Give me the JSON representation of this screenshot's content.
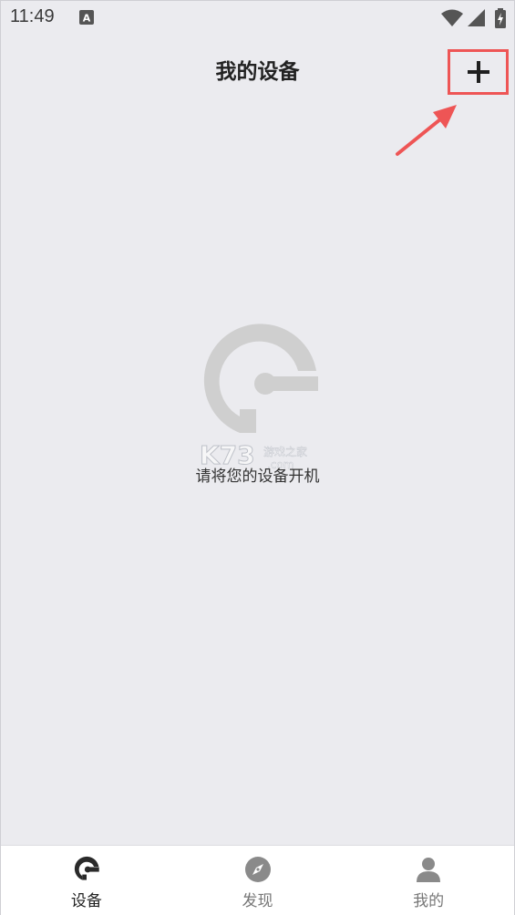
{
  "status_bar": {
    "time": "11:49",
    "notification_icon": "text-a-icon",
    "wifi_icon": "wifi-icon",
    "signal_icon": "signal-icon",
    "battery_icon": "battery-charging-icon"
  },
  "header": {
    "title": "我的设备",
    "add_icon": "plus-icon"
  },
  "annotation": {
    "arrow_icon": "red-arrow-icon",
    "highlight_color": "#ee5555"
  },
  "empty_state": {
    "logo_icon": "device-logo-icon",
    "message": "请将您的设备开机",
    "watermark": {
      "brand": "K73",
      "line1": "游戏之家",
      "line2": ".com"
    }
  },
  "tab_bar": {
    "tabs": [
      {
        "label": "设备",
        "icon": "device-logo-icon",
        "active": true
      },
      {
        "label": "发现",
        "icon": "compass-icon",
        "active": false
      },
      {
        "label": "我的",
        "icon": "user-icon",
        "active": false
      }
    ]
  },
  "colors": {
    "background": "#ebebef",
    "active_icon": "#2a2a2a",
    "inactive_icon": "#8a8a8a",
    "logo_gray": "#cfcfcf"
  }
}
